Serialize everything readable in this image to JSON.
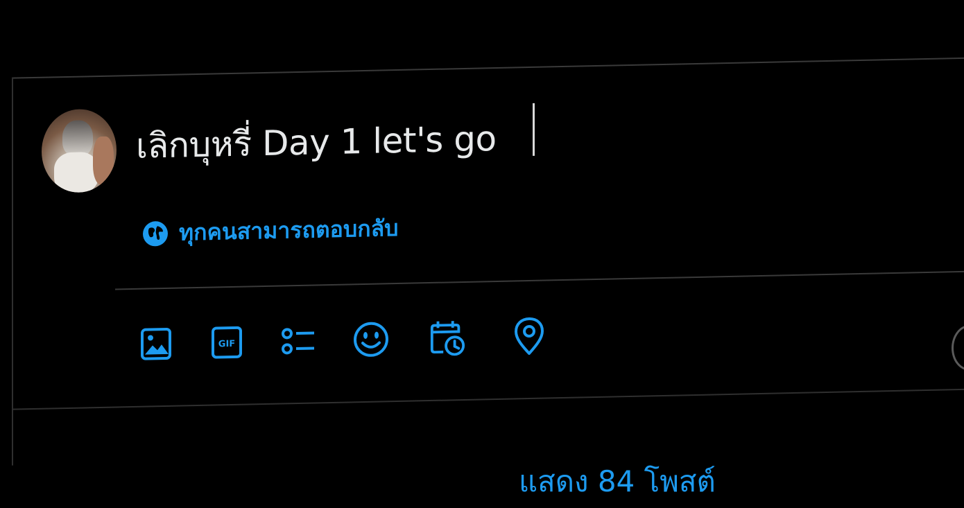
{
  "composer": {
    "text": "เลิกบุหรี่ Day 1 let's go",
    "reply_setting": "ทุกคนสามารถตอบกลับ"
  },
  "toolbar": {
    "icons": [
      "image-icon",
      "gif-icon",
      "poll-icon",
      "emoji-icon",
      "schedule-icon",
      "location-icon"
    ],
    "gif_label": "GIF"
  },
  "timeline": {
    "show_posts": "แสดง 84 โพสต์"
  },
  "colors": {
    "accent": "#1d9bf0",
    "background": "#000000",
    "text": "#e7e9ea",
    "border": "#3a3a3a"
  }
}
